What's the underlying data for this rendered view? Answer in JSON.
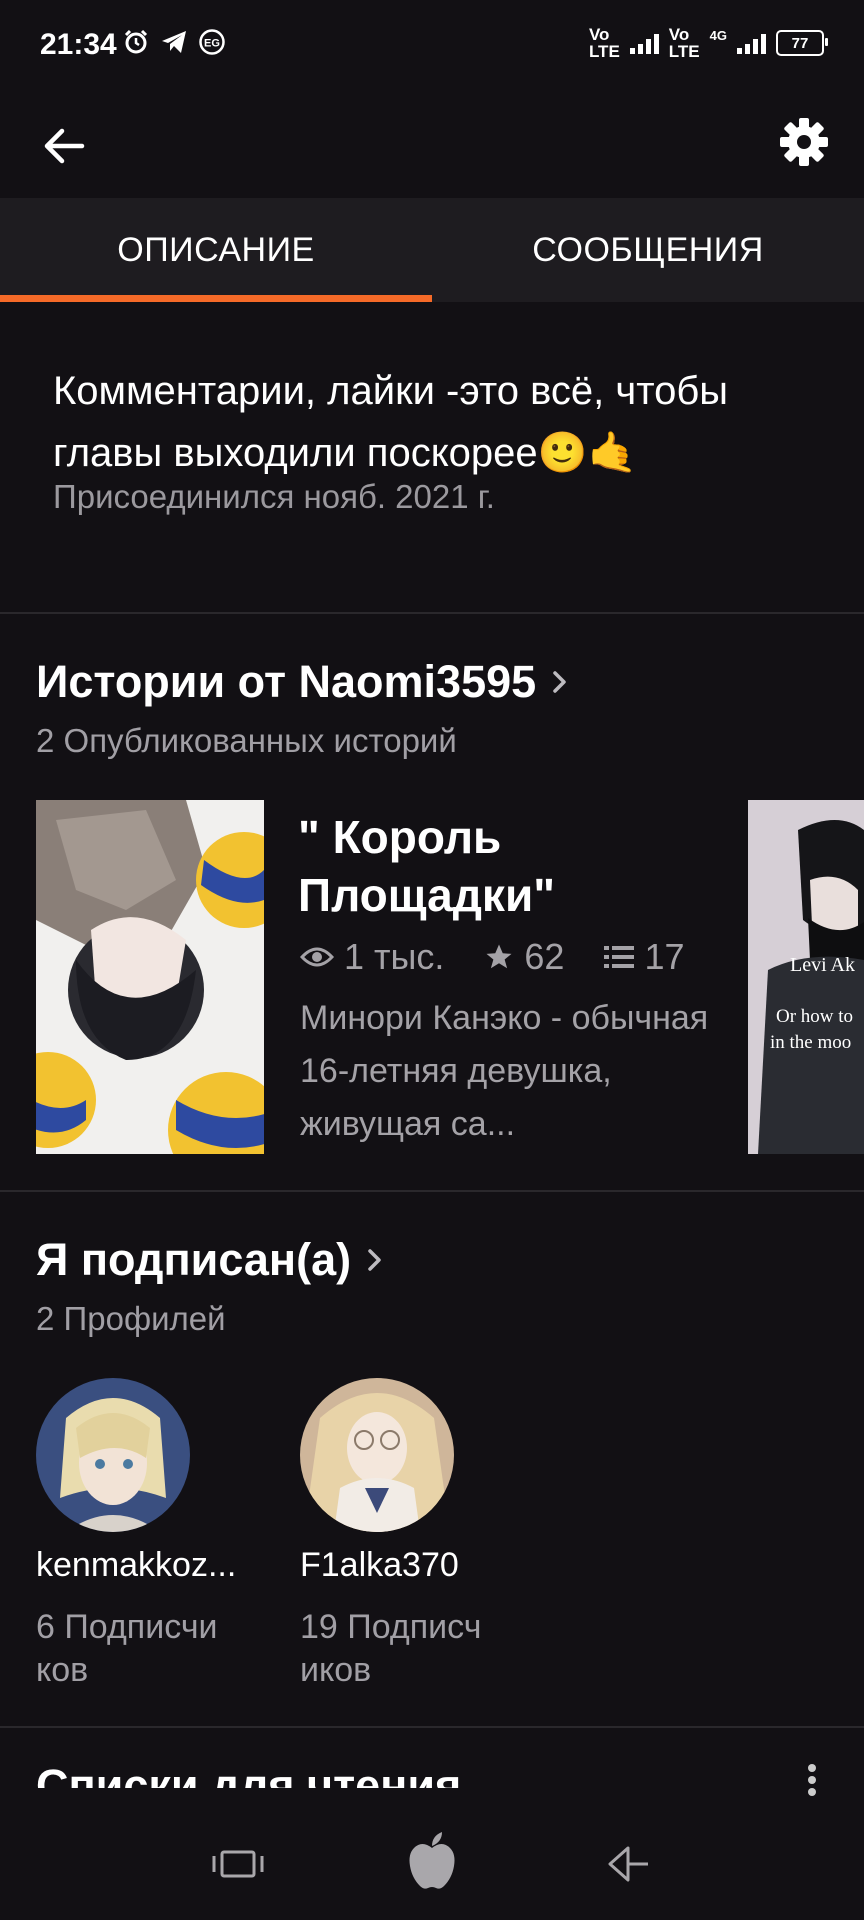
{
  "status_bar": {
    "time": "21:34",
    "badge": "EG",
    "sim1": "Vo)\nLTE",
    "sim2": "Vo)\nLTE",
    "net": "4G",
    "battery": "77"
  },
  "header": {
    "back_icon": "arrow-left-icon",
    "settings_icon": "gear-icon"
  },
  "tabs": [
    {
      "label": "ОПИСАНИЕ",
      "active": true
    },
    {
      "label": "СООБЩЕНИЯ",
      "active": false
    }
  ],
  "about": {
    "description": "Комментарии, лайки -это всё, чтобы главы выходили поскорее🙂🤙",
    "joined": "Присоединился нояб. 2021 г."
  },
  "stories_section": {
    "title": "Истории от Naomi3595",
    "subtitle": "2 Опубликованных историй",
    "stories": [
      {
        "title": "\" Король Площадки\"",
        "views": "1 тыс.",
        "votes": "62",
        "parts": "17",
        "description": "Минори Канэко - обычная 16-летняя девушка, живущая са..."
      },
      {
        "cover_text_1": "Levi Ak",
        "cover_text_2": "Or how to",
        "cover_text_3": "in the moo"
      }
    ]
  },
  "following_section": {
    "title": "Я подписан(а)",
    "subtitle": "2 Профилей",
    "profiles": [
      {
        "name": "kenmakkoz...",
        "count_line1": "6 Подписчи",
        "count_line2": "ков"
      },
      {
        "name": "F1alka370",
        "count_line1": "19 Подписч",
        "count_line2": "иков"
      }
    ]
  },
  "reading_lists": {
    "title": "Списки для чтения"
  },
  "colors": {
    "background": "#121014",
    "accent": "#f56a28",
    "muted_text": "#a19fa5"
  }
}
